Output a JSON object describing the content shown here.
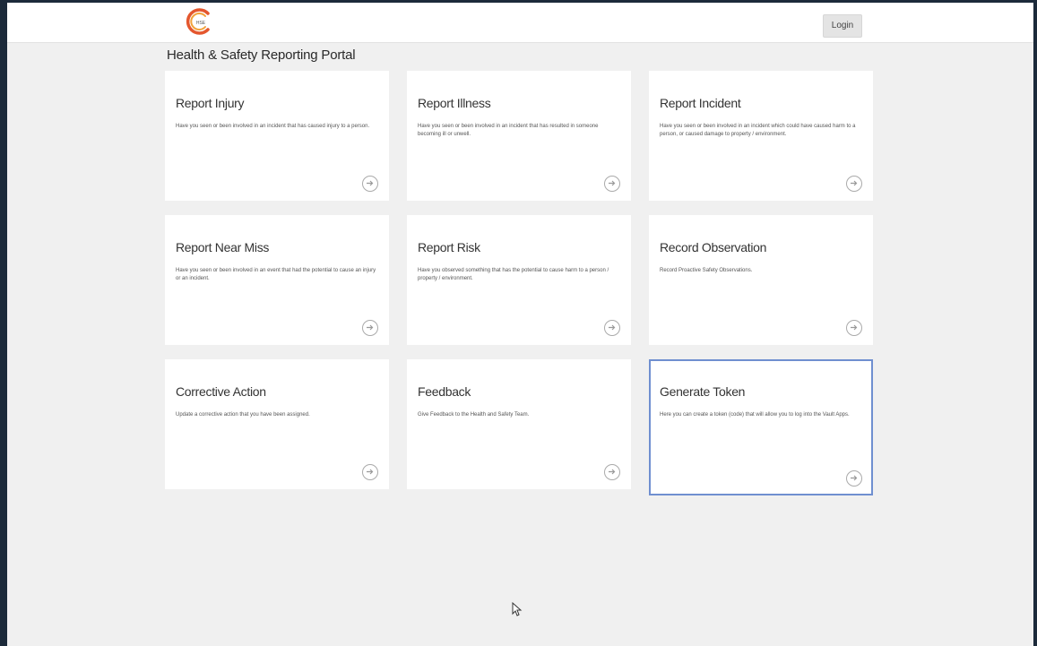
{
  "header": {
    "logo_text": "HSE",
    "login_label": "Login"
  },
  "page": {
    "title": "Health & Safety Reporting Portal"
  },
  "cards": [
    {
      "title": "Report Injury",
      "description": "Have you seen or been involved in an incident that has caused injury to a person."
    },
    {
      "title": "Report Illness",
      "description": "Have you seen or been involved in an incident that has resulted in someone becoming ill or unwell."
    },
    {
      "title": "Report Incident",
      "description": "Have you seen or been involved in an incident which could have caused harm to a person, or caused damage to property / environment."
    },
    {
      "title": "Report Near Miss",
      "description": "Have you seen or been involved in an event that had the potential to cause an injury or an incident."
    },
    {
      "title": "Report Risk",
      "description": "Have you observed something that has the potential to cause harm to a person / property / environment."
    },
    {
      "title": "Record Observation",
      "description": "Record Proactive Safety Observations."
    },
    {
      "title": "Corrective Action",
      "description": "Update a corrective action that you have been assigned."
    },
    {
      "title": "Feedback",
      "description": "Give Feedback to the Health and Safety Team."
    },
    {
      "title": "Generate Token",
      "description": "Here you can create a token (code) that will allow you to log into the Vault Apps."
    }
  ],
  "icons": {
    "card_arrow": "arrow-right-circle-icon",
    "cursor": "mouse-cursor-icon"
  },
  "colors": {
    "background": "#f0f0f0",
    "card": "#ffffff",
    "selected_border": "#6f8fd0",
    "logo_red": "#e4572e",
    "logo_orange": "#f2a33a"
  }
}
